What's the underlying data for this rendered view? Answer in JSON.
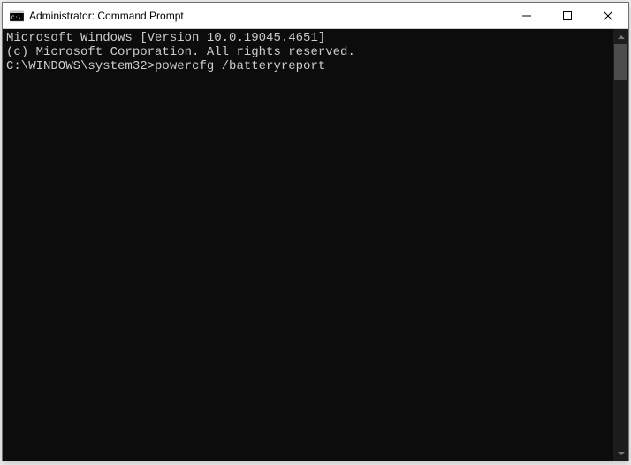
{
  "window": {
    "title": "Administrator: Command Prompt"
  },
  "terminal": {
    "line1": "Microsoft Windows [Version 10.0.19045.4651]",
    "line2": "(c) Microsoft Corporation. All rights reserved.",
    "blank": "",
    "prompt": "C:\\WINDOWS\\system32>",
    "command": "powercfg /batteryreport"
  }
}
